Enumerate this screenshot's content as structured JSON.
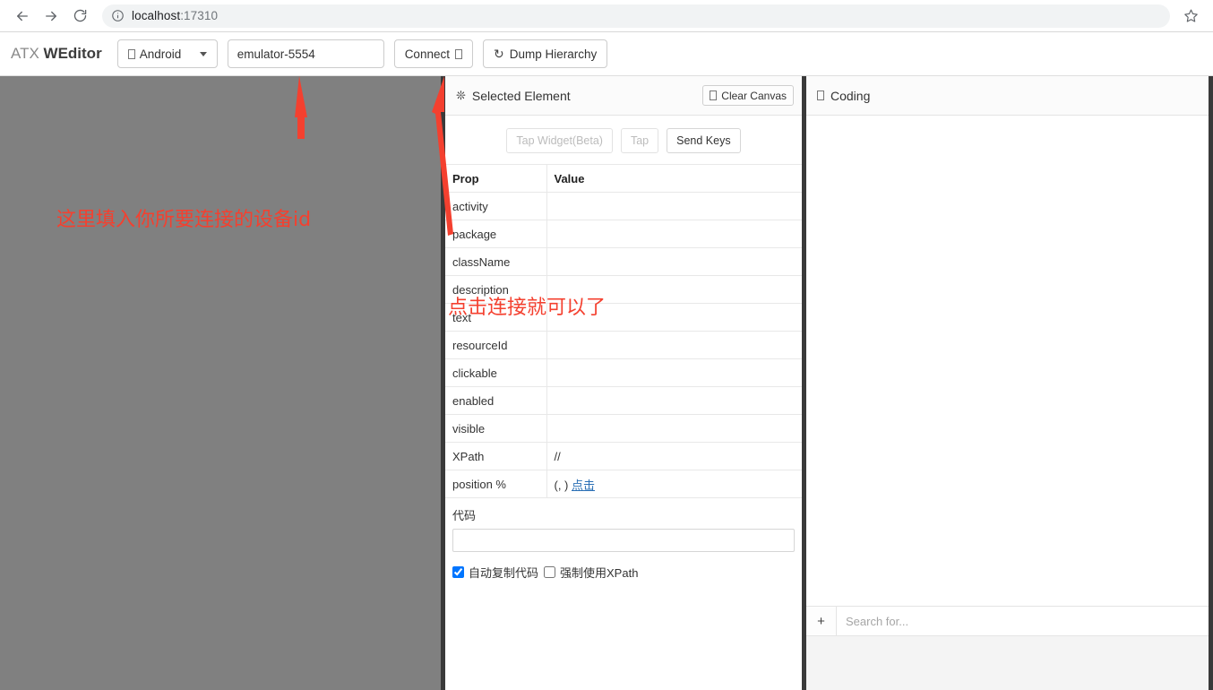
{
  "browser": {
    "back_icon": "back-arrow-icon",
    "forward_icon": "forward-arrow-icon",
    "reload_icon": "reload-icon",
    "info_icon": "site-info-icon",
    "url_host": "localhost",
    "url_port": ":17310",
    "bookmark_icon": "star-icon"
  },
  "header": {
    "brand_prefix": "ATX ",
    "brand_main": "WEditor",
    "platform_select": {
      "value": "Android",
      "icon": "missing-glyph-box",
      "caret_icon": "chevron-down-icon"
    },
    "device_input": {
      "value": "emulator-5554",
      "placeholder": ""
    },
    "connect_button": {
      "label": "Connect",
      "icon": "missing-glyph-box"
    },
    "dump_button": {
      "label": "Dump Hierarchy",
      "icon": "refresh-icon"
    }
  },
  "inspector": {
    "title": "Selected Element",
    "title_icon": "asterisk-circle-icon",
    "clear_canvas": {
      "label": "Clear Canvas",
      "icon": "missing-glyph-box"
    },
    "actions": [
      {
        "label": "Tap Widget(Beta)",
        "disabled": true
      },
      {
        "label": "Tap",
        "disabled": true
      },
      {
        "label": "Send Keys",
        "disabled": false
      }
    ],
    "table": {
      "headers": [
        "Prop",
        "Value"
      ],
      "rows": [
        {
          "prop": "activity",
          "value": ""
        },
        {
          "prop": "package",
          "value": ""
        },
        {
          "prop": "className",
          "value": ""
        },
        {
          "prop": "description",
          "value": ""
        },
        {
          "prop": "text",
          "value": ""
        },
        {
          "prop": "resourceId",
          "value": ""
        },
        {
          "prop": "clickable",
          "value": ""
        },
        {
          "prop": "enabled",
          "value": ""
        },
        {
          "prop": "visible",
          "value": ""
        },
        {
          "prop": "XPath",
          "value": "//"
        },
        {
          "prop": "position %",
          "value": "(, )",
          "link": "点击"
        }
      ]
    },
    "code_label": "代码",
    "code_value": "",
    "checkboxes": [
      {
        "label": "自动复制代码",
        "checked": true
      },
      {
        "label": "强制使用XPath",
        "checked": false
      }
    ]
  },
  "coding": {
    "title": "Coding",
    "title_icon": "missing-glyph-box",
    "add_button": "+",
    "search_placeholder": "Search for..."
  },
  "annotations": {
    "device_note": "这里填入你所要连接的设备id",
    "connect_note": "点击连接就可以了",
    "color": "#f4402f"
  }
}
